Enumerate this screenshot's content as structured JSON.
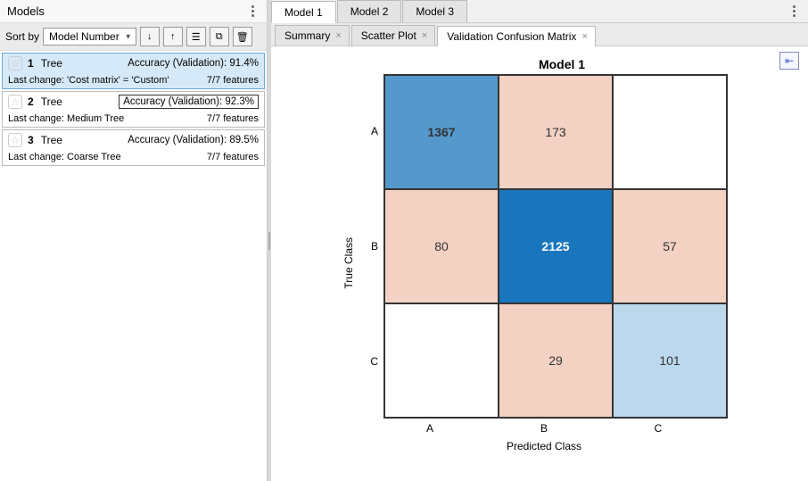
{
  "left": {
    "title": "Models",
    "sort_label": "Sort by",
    "sort_value": "Model Number",
    "models": [
      {
        "num": "1",
        "type": "Tree",
        "accuracy": "Accuracy (Validation): 91.4%",
        "last_change": "Last change: 'Cost matrix' = 'Custom'",
        "features": "7/7 features",
        "selected": true,
        "boxed": false
      },
      {
        "num": "2",
        "type": "Tree",
        "accuracy": "Accuracy (Validation): 92.3%",
        "last_change": "Last change: Medium Tree",
        "features": "7/7 features",
        "selected": false,
        "boxed": true
      },
      {
        "num": "3",
        "type": "Tree",
        "accuracy": "Accuracy (Validation): 89.5%",
        "last_change": "Last change: Coarse Tree",
        "features": "7/7 features",
        "selected": false,
        "boxed": false
      }
    ]
  },
  "top_tabs": [
    "Model 1",
    "Model 2",
    "Model 3"
  ],
  "sub_tabs": [
    "Summary",
    "Scatter Plot",
    "Validation Confusion Matrix"
  ],
  "chart_data": {
    "type": "heatmap",
    "title": "Model 1",
    "xlabel": "Predicted Class",
    "ylabel": "True Class",
    "categories": [
      "A",
      "B",
      "C"
    ],
    "matrix": [
      [
        1367,
        173,
        null
      ],
      [
        80,
        2125,
        57
      ],
      [
        null,
        29,
        101
      ]
    ],
    "colors": [
      [
        "#5599cc",
        "#f3d2c3",
        "#ffffff"
      ],
      [
        "#f3d2c3",
        "#1976bd",
        "#f3d2c3"
      ],
      [
        "#ffffff",
        "#f3d2c3",
        "#bbd8ec"
      ]
    ],
    "textcolors": [
      [
        "#333",
        "#333",
        "#333"
      ],
      [
        "#333",
        "#fff",
        "#333"
      ],
      [
        "#333",
        "#333",
        "#333"
      ]
    ]
  }
}
